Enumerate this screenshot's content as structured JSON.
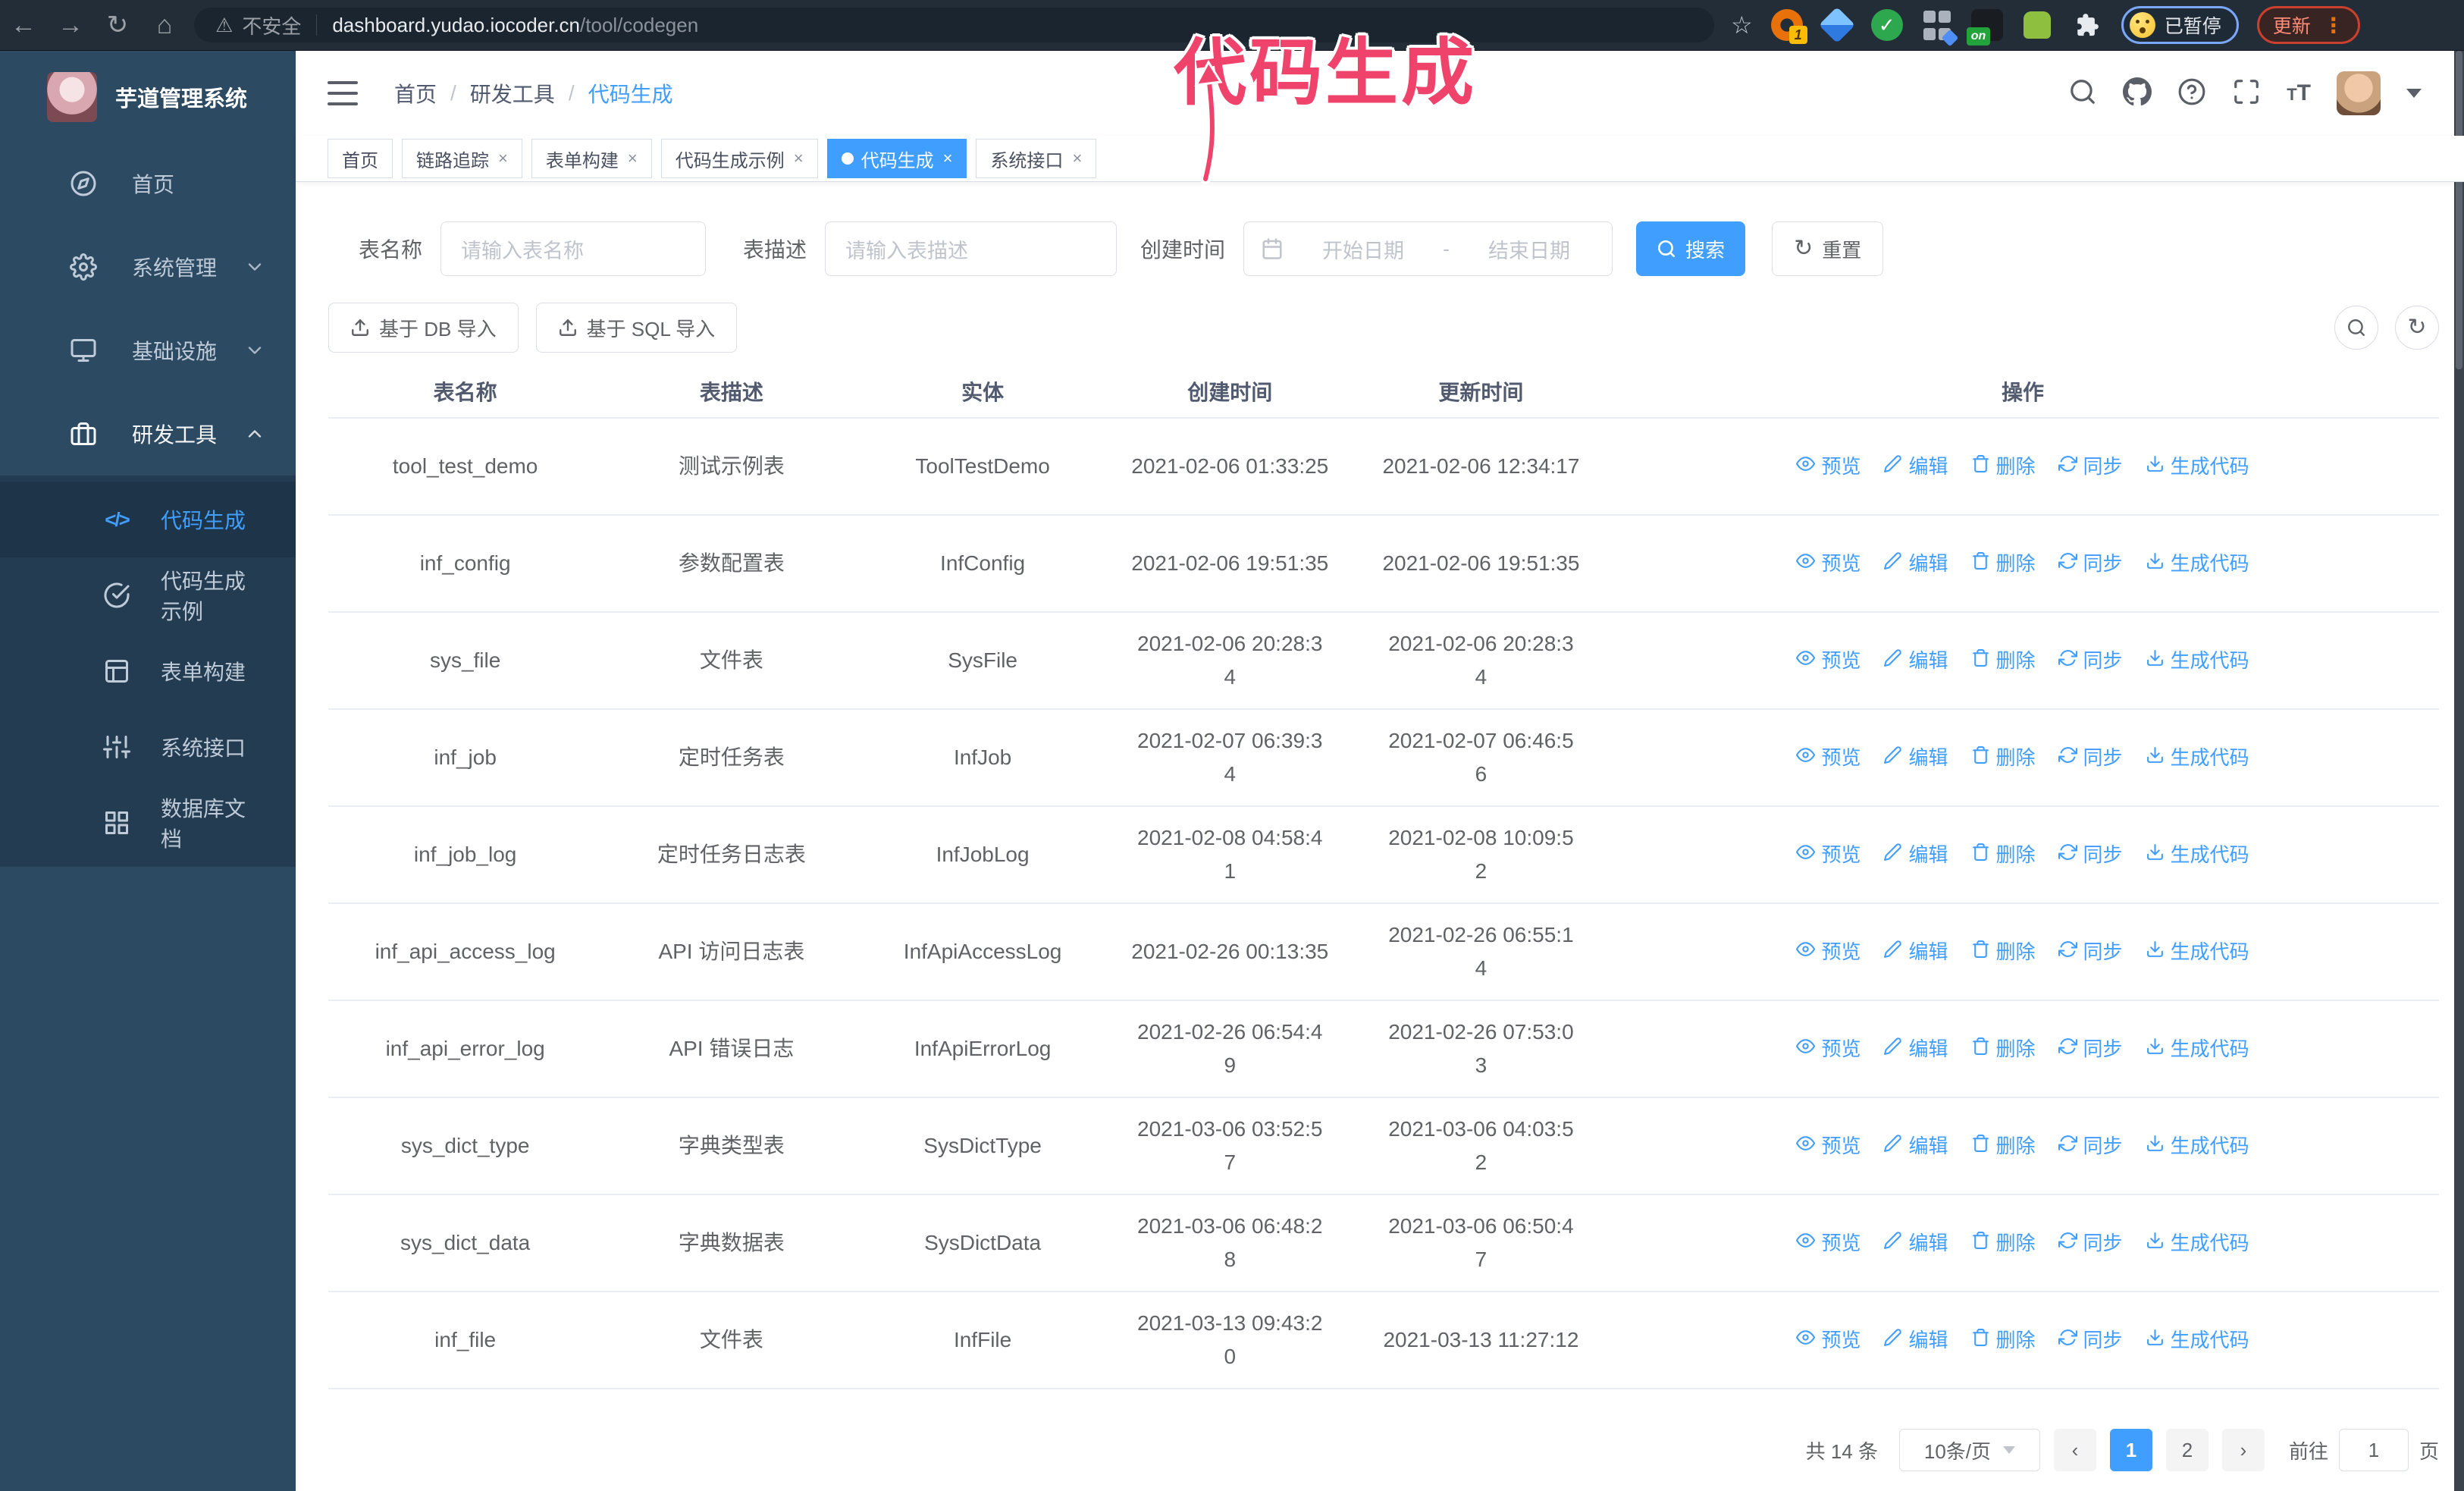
{
  "colors": {
    "primary": "#409eff",
    "annotation_pink": "#f0436b",
    "sidebar_bg": "#2d4a63",
    "submenu_bg": "#233c52",
    "chrome_bg": "#222d38"
  },
  "browser": {
    "insecure_label": "不安全",
    "url_host": "dashboard.yudao.iocoder.cn",
    "url_path": "/tool/codegen",
    "paused_badge": "已暂停",
    "update_button": "更新",
    "menu_dots": "⋮",
    "extension_badge_1": "1",
    "extension_on_badge": "on"
  },
  "annotation": {
    "text": "代码生成"
  },
  "sidebar": {
    "title": "芋道管理系统",
    "items": [
      {
        "label": "首页",
        "icon": "home",
        "chevron": null,
        "active": false
      },
      {
        "label": "系统管理",
        "icon": "gear",
        "chevron": "down",
        "active": false
      },
      {
        "label": "基础设施",
        "icon": "monitor",
        "chevron": "down",
        "active": false
      },
      {
        "label": "研发工具",
        "icon": "toolbox",
        "chevron": "up",
        "active": true
      }
    ],
    "submenu": [
      {
        "label": "代码生成",
        "icon": "code",
        "active": true
      },
      {
        "label": "代码生成示例",
        "icon": "badge-check",
        "active": false
      },
      {
        "label": "表单构建",
        "icon": "form",
        "active": false
      },
      {
        "label": "系统接口",
        "icon": "sliders",
        "active": false
      },
      {
        "label": "数据库文档",
        "icon": "database",
        "active": false
      }
    ]
  },
  "header": {
    "breadcrumb": [
      "首页",
      "研发工具",
      "代码生成"
    ]
  },
  "tabs": [
    {
      "label": "首页",
      "closable": false,
      "active": false
    },
    {
      "label": "链路追踪",
      "closable": true,
      "active": false
    },
    {
      "label": "表单构建",
      "closable": true,
      "active": false
    },
    {
      "label": "代码生成示例",
      "closable": true,
      "active": false
    },
    {
      "label": "代码生成",
      "closable": true,
      "active": true
    },
    {
      "label": "系统接口",
      "closable": true,
      "active": false
    }
  ],
  "filters": {
    "table_name_label": "表名称",
    "table_name_placeholder": "请输入表名称",
    "table_desc_label": "表描述",
    "table_desc_placeholder": "请输入表描述",
    "create_time_label": "创建时间",
    "date_start_placeholder": "开始日期",
    "date_separator": "-",
    "date_end_placeholder": "结束日期",
    "search_label": "搜索",
    "reset_label": "重置"
  },
  "toolbar": {
    "import_db_label": "基于 DB 导入",
    "import_sql_label": "基于 SQL 导入"
  },
  "table": {
    "columns": [
      "表名称",
      "表描述",
      "实体",
      "创建时间",
      "更新时间",
      "操作"
    ],
    "actions": [
      {
        "label": "预览",
        "icon": "eye"
      },
      {
        "label": "编辑",
        "icon": "edit"
      },
      {
        "label": "删除",
        "icon": "trash"
      },
      {
        "label": "同步",
        "icon": "refresh"
      },
      {
        "label": "生成代码",
        "icon": "download"
      }
    ],
    "rows": [
      {
        "name": "tool_test_demo",
        "desc": "测试示例表",
        "entity": "ToolTestDemo",
        "created": [
          "2021-02-06 01:33:25"
        ],
        "updated": [
          "2021-02-06 12:34:17"
        ]
      },
      {
        "name": "inf_config",
        "desc": "参数配置表",
        "entity": "InfConfig",
        "created": [
          "2021-02-06 19:51:35"
        ],
        "updated": [
          "2021-02-06 19:51:35"
        ]
      },
      {
        "name": "sys_file",
        "desc": "文件表",
        "entity": "SysFile",
        "created": [
          "2021-02-06 20:28:3",
          "4"
        ],
        "updated": [
          "2021-02-06 20:28:3",
          "4"
        ]
      },
      {
        "name": "inf_job",
        "desc": "定时任务表",
        "entity": "InfJob",
        "created": [
          "2021-02-07 06:39:3",
          "4"
        ],
        "updated": [
          "2021-02-07 06:46:5",
          "6"
        ]
      },
      {
        "name": "inf_job_log",
        "desc": "定时任务日志表",
        "entity": "InfJobLog",
        "created": [
          "2021-02-08 04:58:4",
          "1"
        ],
        "updated": [
          "2021-02-08 10:09:5",
          "2"
        ]
      },
      {
        "name": "inf_api_access_log",
        "desc": "API 访问日志表",
        "entity": "InfApiAccessLog",
        "created": [
          "2021-02-26 00:13:35"
        ],
        "updated": [
          "2021-02-26 06:55:1",
          "4"
        ]
      },
      {
        "name": "inf_api_error_log",
        "desc": "API 错误日志",
        "entity": "InfApiErrorLog",
        "created": [
          "2021-02-26 06:54:4",
          "9"
        ],
        "updated": [
          "2021-02-26 07:53:0",
          "3"
        ]
      },
      {
        "name": "sys_dict_type",
        "desc": "字典类型表",
        "entity": "SysDictType",
        "created": [
          "2021-03-06 03:52:5",
          "7"
        ],
        "updated": [
          "2021-03-06 04:03:5",
          "2"
        ]
      },
      {
        "name": "sys_dict_data",
        "desc": "字典数据表",
        "entity": "SysDictData",
        "created": [
          "2021-03-06 06:48:2",
          "8"
        ],
        "updated": [
          "2021-03-06 06:50:4",
          "7"
        ]
      },
      {
        "name": "inf_file",
        "desc": "文件表",
        "entity": "InfFile",
        "created": [
          "2021-03-13 09:43:2",
          "0"
        ],
        "updated": [
          "2021-03-13 11:27:12"
        ]
      }
    ]
  },
  "pagination": {
    "total_label": "共 14 条",
    "page_size": "10条/页",
    "pages": [
      "1",
      "2"
    ],
    "active_page": "1",
    "goto_label": "前往",
    "goto_value": "1",
    "goto_suffix": "页"
  }
}
